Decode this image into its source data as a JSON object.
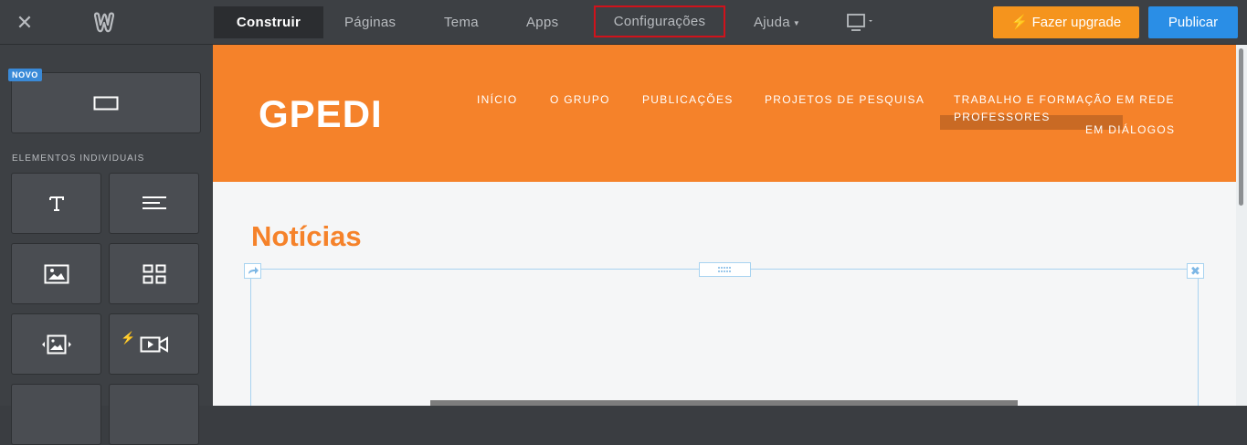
{
  "topbar": {
    "close_icon": "close-icon",
    "logo_icon": "weebly-logo-icon",
    "nav": [
      {
        "label": "Construir",
        "active": true
      },
      {
        "label": "Páginas"
      },
      {
        "label": "Tema"
      },
      {
        "label": "Apps"
      },
      {
        "label": "Configurações",
        "highlighted": true
      },
      {
        "label": "Ajuda",
        "has_caret": true
      }
    ],
    "device_icon": "desktop-monitor-icon",
    "upgrade_label": "Fazer upgrade",
    "publish_label": "Publicar",
    "colors": {
      "upgrade": "#f5941d",
      "publish": "#2a8ee6",
      "highlight_border": "#d0121b"
    }
  },
  "sidebar": {
    "new_badge": "NOVO",
    "section_label": "ELEMENTOS INDIVIDUAIS",
    "tiles": [
      {
        "icon": "section-icon"
      },
      {
        "icon": "title-icon"
      },
      {
        "icon": "text-icon"
      },
      {
        "icon": "image-icon"
      },
      {
        "icon": "gallery-icon"
      },
      {
        "icon": "slideshow-icon"
      },
      {
        "icon": "video-icon"
      }
    ]
  },
  "site": {
    "title": "GPEDI",
    "nav": [
      "INÍCIO",
      "O GRUPO",
      "PUBLICAÇÕES",
      "PROJETOS DE PESQUISA",
      "TRABALHO E FORMAÇÃO EM REDE"
    ],
    "subnav": [
      "PROFESSORES",
      "EM DIÁLOGOS"
    ],
    "header_color": "#f5822a",
    "news_title": "Notícias"
  }
}
